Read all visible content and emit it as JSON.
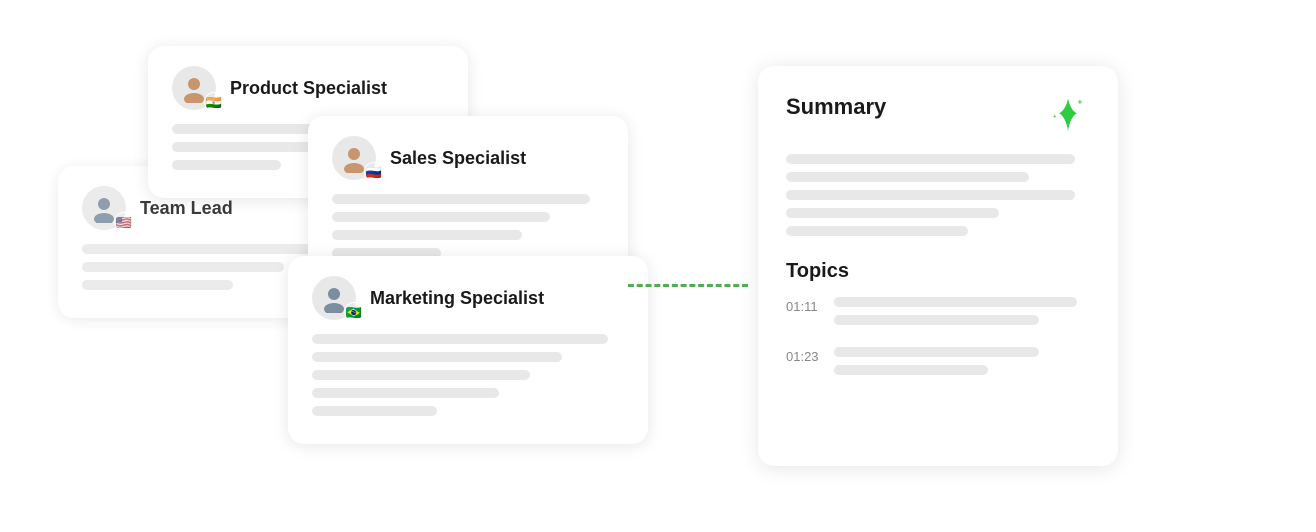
{
  "cards": {
    "team_lead": {
      "title": "Team Lead",
      "flag": "🇺🇸",
      "person_color": "#7b8ea0"
    },
    "product_specialist": {
      "title": "Product Specialist",
      "flag": "🇮🇳",
      "person_color": "#c8956c"
    },
    "sales_specialist": {
      "title": "Sales Specialist",
      "flag": "🇷🇺",
      "person_color": "#c8956c"
    },
    "marketing_specialist": {
      "title": "Marketing Specialist",
      "flag": "🇧🇷",
      "person_color": "#7b8ea0"
    }
  },
  "summary": {
    "title": "Summary",
    "sparkle_label": "AI sparkle icon",
    "topics_title": "Topics",
    "topics": [
      {
        "time": "01:11"
      },
      {
        "time": "01:23"
      }
    ]
  }
}
